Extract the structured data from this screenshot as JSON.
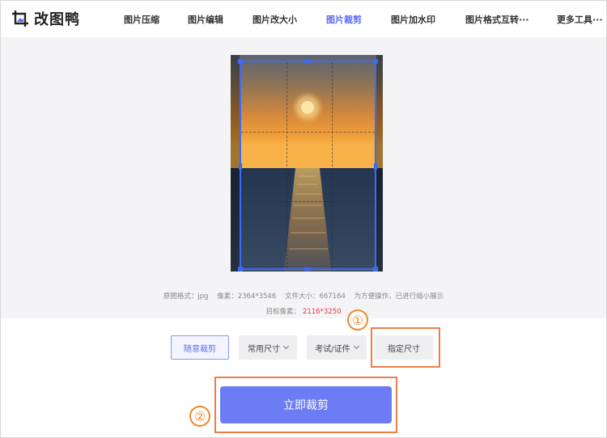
{
  "app": {
    "name": "改图鸭",
    "logo_icon": "image-crop-logo-icon"
  },
  "nav": {
    "items": [
      {
        "label": "图片压缩"
      },
      {
        "label": "图片编辑"
      },
      {
        "label": "图片改大小"
      },
      {
        "label": "图片裁剪",
        "active": true
      },
      {
        "label": "图片加水印"
      },
      {
        "label": "图片格式互转···"
      },
      {
        "label": "更多工具···"
      }
    ]
  },
  "preview": {
    "original_format_label": "原图格式：jpg",
    "pixels_label": "像素：2364*3546",
    "file_size_label": "文件大小：667164",
    "note": "为方便操作，已进行缩小展示",
    "target_label": "目标像素：",
    "target_value": "2116*3250"
  },
  "options": {
    "free_crop": "随意裁剪",
    "common_size": "常用尺寸",
    "exam_id": "考试/证件",
    "custom_size": "指定尺寸"
  },
  "actions": {
    "crop_now": "立即裁剪"
  },
  "annotations": {
    "step1": "①",
    "step2": "②"
  },
  "colors": {
    "accent": "#5b6cf0",
    "primary_button": "#6b7cf5",
    "crop_frame": "#3b6cf6",
    "annotation": "#ef7d4a",
    "target_value": "#e03c3c"
  }
}
